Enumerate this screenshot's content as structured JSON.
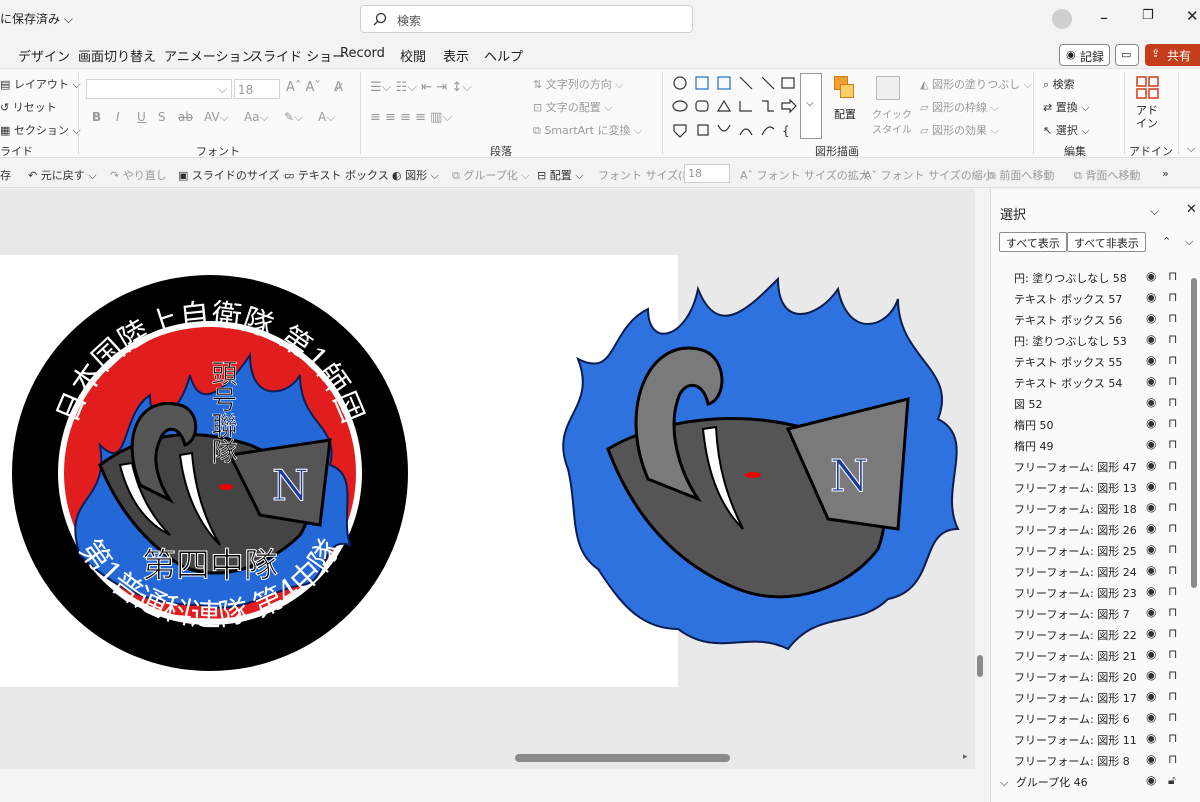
{
  "titlebar": {
    "save_status": "に保存済み ⌵",
    "search_placeholder": "検索"
  },
  "tabs": [
    "デザイン",
    "画面切り替え",
    "アニメーション",
    "スライド ショー",
    "Record",
    "校閲",
    "表示",
    "ヘルプ"
  ],
  "header_buttons": {
    "record": "記録",
    "share": "共有"
  },
  "ribbon": {
    "slides": {
      "layout": "レイアウト",
      "reset": "リセット",
      "section": "セクション",
      "label": "ライド"
    },
    "font": {
      "size": "18",
      "label": "フォント"
    },
    "paragraph": {
      "text_direction": "文字列の方向",
      "text_align": "文字の配置",
      "smartart": "SmartArt に変換",
      "label": "段落"
    },
    "drawing": {
      "arrange": "配置",
      "quick_styles": "クイック\nスタイル",
      "fill": "図形の塗りつぶし",
      "outline": "図形の枠線",
      "effects": "図形の効果",
      "label": "図形描画"
    },
    "editing": {
      "find": "検索",
      "replace": "置換",
      "select": "選択",
      "label": "編集"
    },
    "addins": {
      "button": "アド\nイン",
      "label": "アドイン"
    }
  },
  "qat": {
    "save": "存",
    "undo": "元に戻す",
    "redo": "やり直し",
    "slide_size": "スライドのサイズ",
    "textbox": "テキスト ボックス",
    "shapes": "図形",
    "group": "グループ化",
    "arrange": "配置",
    "font_size_label": "フォント サイズ(F):",
    "font_size": "18",
    "grow_font": "フォント サイズの拡大",
    "shrink_font": "フォント サイズの縮小",
    "bring_forward": "前面へ移動",
    "send_backward": "背面へ移動",
    "more": "»"
  },
  "emblem": {
    "ring_top": "日本国陸上自衛隊 第1師団",
    "ring_bottom": "第1普通科連隊 第4中隊",
    "vertical": "頭号聯隊",
    "center": "第四中隊",
    "letter": "N"
  },
  "selection_pane": {
    "title": "選択",
    "show_all": "すべて表示",
    "hide_all": "すべて非表示",
    "items": [
      "円: 塗りつぶしなし 58",
      "テキスト ボックス 57",
      "テキスト ボックス 56",
      "円: 塗りつぶしなし 53",
      "テキスト ボックス 55",
      "テキスト ボックス 54",
      "図 52",
      "楕円 50",
      "楕円 49",
      "フリーフォーム: 図形 47",
      "フリーフォーム: 図形 13",
      "フリーフォーム: 図形 18",
      "フリーフォーム: 図形 26",
      "フリーフォーム: 図形 25",
      "フリーフォーム: 図形 24",
      "フリーフォーム: 図形 23",
      "フリーフォーム: 図形 7",
      "フリーフォーム: 図形 22",
      "フリーフォーム: 図形 21",
      "フリーフォーム: 図形 20",
      "フリーフォーム: 図形 17",
      "フリーフォーム: 図形 6",
      "フリーフォーム: 図形 11",
      "フリーフォーム: 図形 8"
    ],
    "group_item": "グループ化 46"
  }
}
